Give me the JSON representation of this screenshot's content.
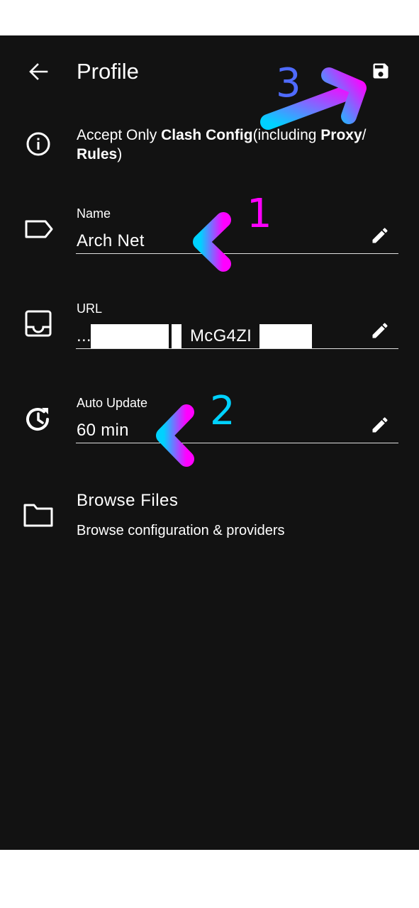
{
  "header": {
    "title": "Profile",
    "back_icon": "arrow-back-icon",
    "save_icon": "save-icon"
  },
  "info": {
    "prefix": "Accept Only ",
    "bold1": "Clash Config",
    "middle": "(including ",
    "bold2": "Proxy",
    "slash": "/ ",
    "bold3": "Rules",
    "suffix": ")"
  },
  "fields": {
    "name": {
      "label": "Name",
      "value": "Arch Net",
      "icon": "label-icon"
    },
    "url": {
      "label": "URL",
      "value_prefix": "...",
      "value_visible": "McG4ZI",
      "icon": "inbox-icon"
    },
    "auto_update": {
      "label": "Auto Update",
      "value": "60 min",
      "icon": "update-clock-icon"
    }
  },
  "browse": {
    "title": "Browse Files",
    "subtitle": "Browse configuration & providers",
    "icon": "folder-icon"
  },
  "annotations": {
    "n1": "1",
    "n2": "2",
    "n3": "3"
  },
  "colors": {
    "background": "#121212",
    "text": "#ffffff",
    "arrow_cyan": "#00d2ff",
    "arrow_magenta": "#ff00ff"
  }
}
